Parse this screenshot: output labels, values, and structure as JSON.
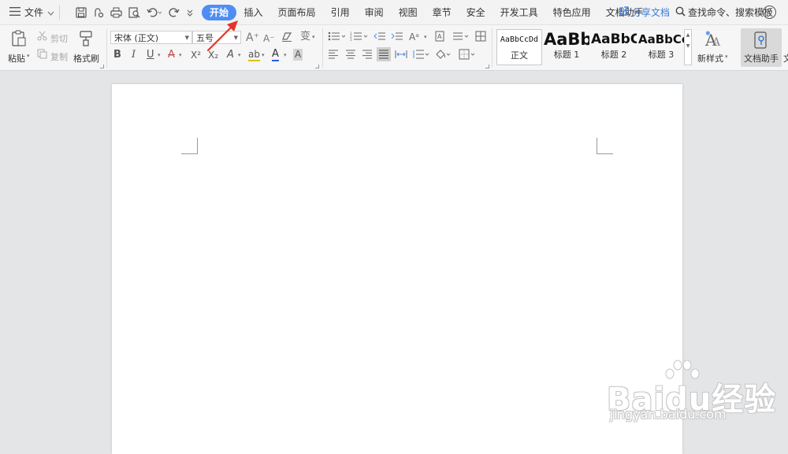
{
  "menubar": {
    "file_label": "文件",
    "tabs": [
      "开始",
      "插入",
      "页面布局",
      "引用",
      "审阅",
      "视图",
      "章节",
      "安全",
      "开发工具",
      "特色应用",
      "文档助手"
    ],
    "active_tab": "开始",
    "share_label": "分享文档",
    "search_label": "查找命令、搜索模板",
    "help_label": "?",
    "accent_color": "#4f8df5"
  },
  "ribbon": {
    "clipboard": {
      "paste_label": "粘贴",
      "cut_label": "剪切",
      "copy_label": "复制",
      "format_painter_label": "格式刷"
    },
    "font": {
      "font_name": "宋体 (正文)",
      "font_size": "五号",
      "bold": "B",
      "italic": "I",
      "underline": "U",
      "strike": "A",
      "superscript": "X²",
      "subscript": "X₂",
      "text_effect": "A",
      "highlight": "ab",
      "font_color": "A",
      "char_shade": "A",
      "grow": "A⁺",
      "shrink": "A⁻",
      "phonetic": "变"
    },
    "styles": {
      "cards": [
        {
          "sample": "AaBbCcDd",
          "label": "正文"
        },
        {
          "sample": "AaBb",
          "label": "标题 1"
        },
        {
          "sample": "AaBbC",
          "label": "标题 2"
        },
        {
          "sample": "AaBbCc",
          "label": "标题 3"
        }
      ],
      "new_style_label": "新样式",
      "assistant_label": "文档助手",
      "trailing_label": "文"
    }
  },
  "watermark": {
    "logo": "Baidu经验",
    "url": "jingyan.baidu.com"
  }
}
